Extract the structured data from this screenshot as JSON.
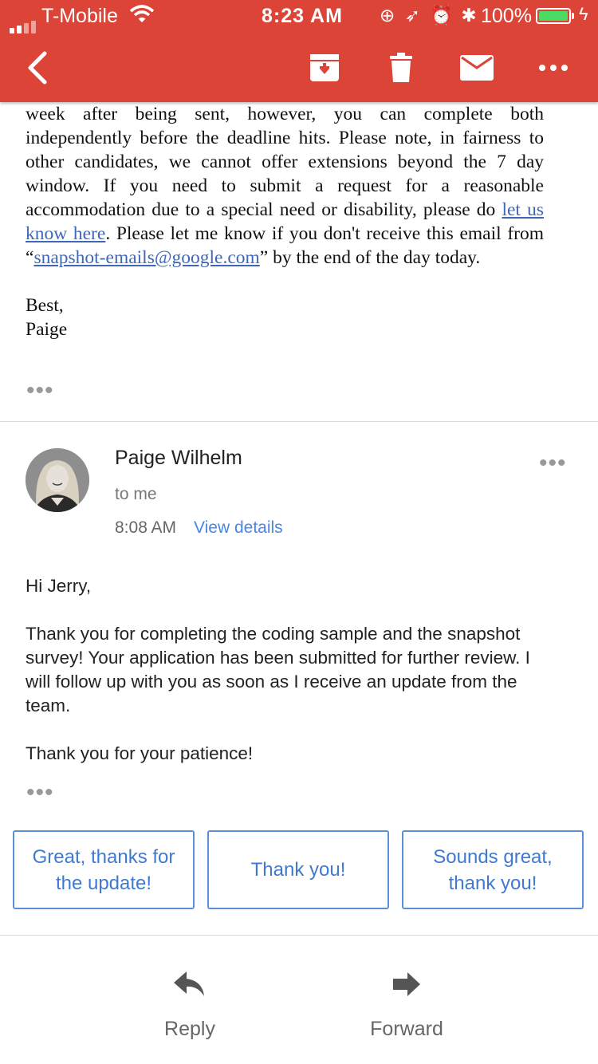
{
  "status_bar": {
    "carrier": "T-Mobile",
    "time": "8:23 AM",
    "battery": "100%",
    "colors": {
      "battery_fill": "#4cd964"
    }
  },
  "app_bar": {
    "color": "#db4437",
    "actions": [
      "back-icon",
      "archive-icon",
      "trash-icon",
      "mail-icon",
      "more-icon"
    ]
  },
  "previous_message": {
    "text_before_link": "week after being sent, however, you can complete both independently before the deadline hits. Please note, in fairness to other candidates, we cannot offer extensions beyond the 7 day window. If you need to submit a request for a reasonable accommodation due to a special need or disability, please do ",
    "link1": "let us know here",
    "text_after_link": ". Please let me know if you don't receive this email from “",
    "email_link": "snapshot-emails@google.com",
    "text_end": "” by the end of the day today.",
    "closing": "Best,",
    "signature": "Paige"
  },
  "message": {
    "sender": "Paige Wilhelm",
    "recipient": "to me",
    "time": "8:08 AM",
    "view_details": "View details",
    "greeting": "Hi Jerry,",
    "paragraph": "Thank you for completing the coding sample and the snapshot survey! Your application has been submitted for further review. I will follow up with you as soon as I receive an update from the team.",
    "closing": "Thank you for your patience!"
  },
  "smart_replies": [
    "Great, thanks for the update!",
    "Thank you!",
    "Sounds great, thank you!"
  ],
  "actions": {
    "reply": "Reply",
    "forward": "Forward"
  }
}
